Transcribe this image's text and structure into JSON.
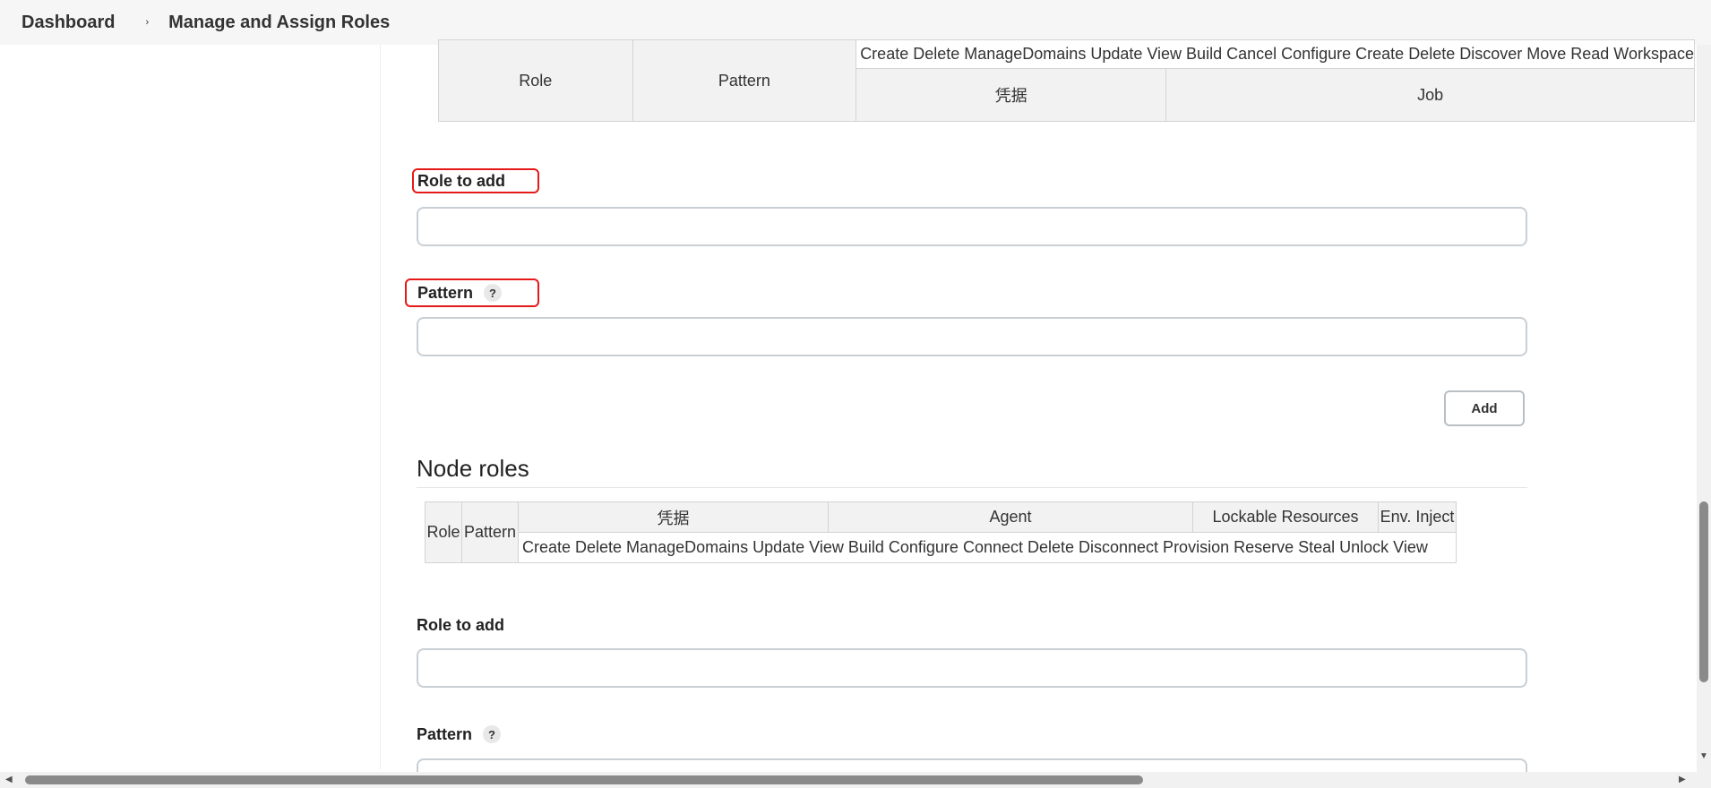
{
  "breadcrumb": {
    "items": [
      "Dashboard",
      "Manage and Assign Roles"
    ],
    "separator": "›"
  },
  "item_roles_table": {
    "permissions": "Create  Delete  ManageDomains  Update  View  Build  Cancel  Configure  Create  Delete  Discover  Move  Read  Workspace",
    "role_header": "Role",
    "pattern_header": "Pattern",
    "groups": [
      "凭据",
      "Job"
    ]
  },
  "item_role_form": {
    "role_label": "Role to add",
    "role_value": "",
    "pattern_label": "Pattern",
    "pattern_help": "?",
    "pattern_value": "",
    "add_button": "Add"
  },
  "node_roles": {
    "title": "Node roles",
    "role_header": "Role",
    "pattern_header": "Pattern",
    "groups": [
      "凭据",
      "Agent",
      "Lockable Resources",
      "Env. Inject"
    ],
    "permissions": "Create  Delete  ManageDomains  Update  View  Build  Configure  Connect  Delete  Disconnect  Provision  Reserve  Steal  Unlock  View",
    "role_label": "Role to add",
    "role_value": "",
    "pattern_label": "Pattern",
    "pattern_help": "?"
  },
  "scrollbars": {
    "horizontal_left_arrow": "◀",
    "horizontal_right_arrow": "▶",
    "vertical_down_arrow": "▼"
  },
  "colors": {
    "highlight": "#e61919",
    "header_bg": "#f6f6f6"
  }
}
